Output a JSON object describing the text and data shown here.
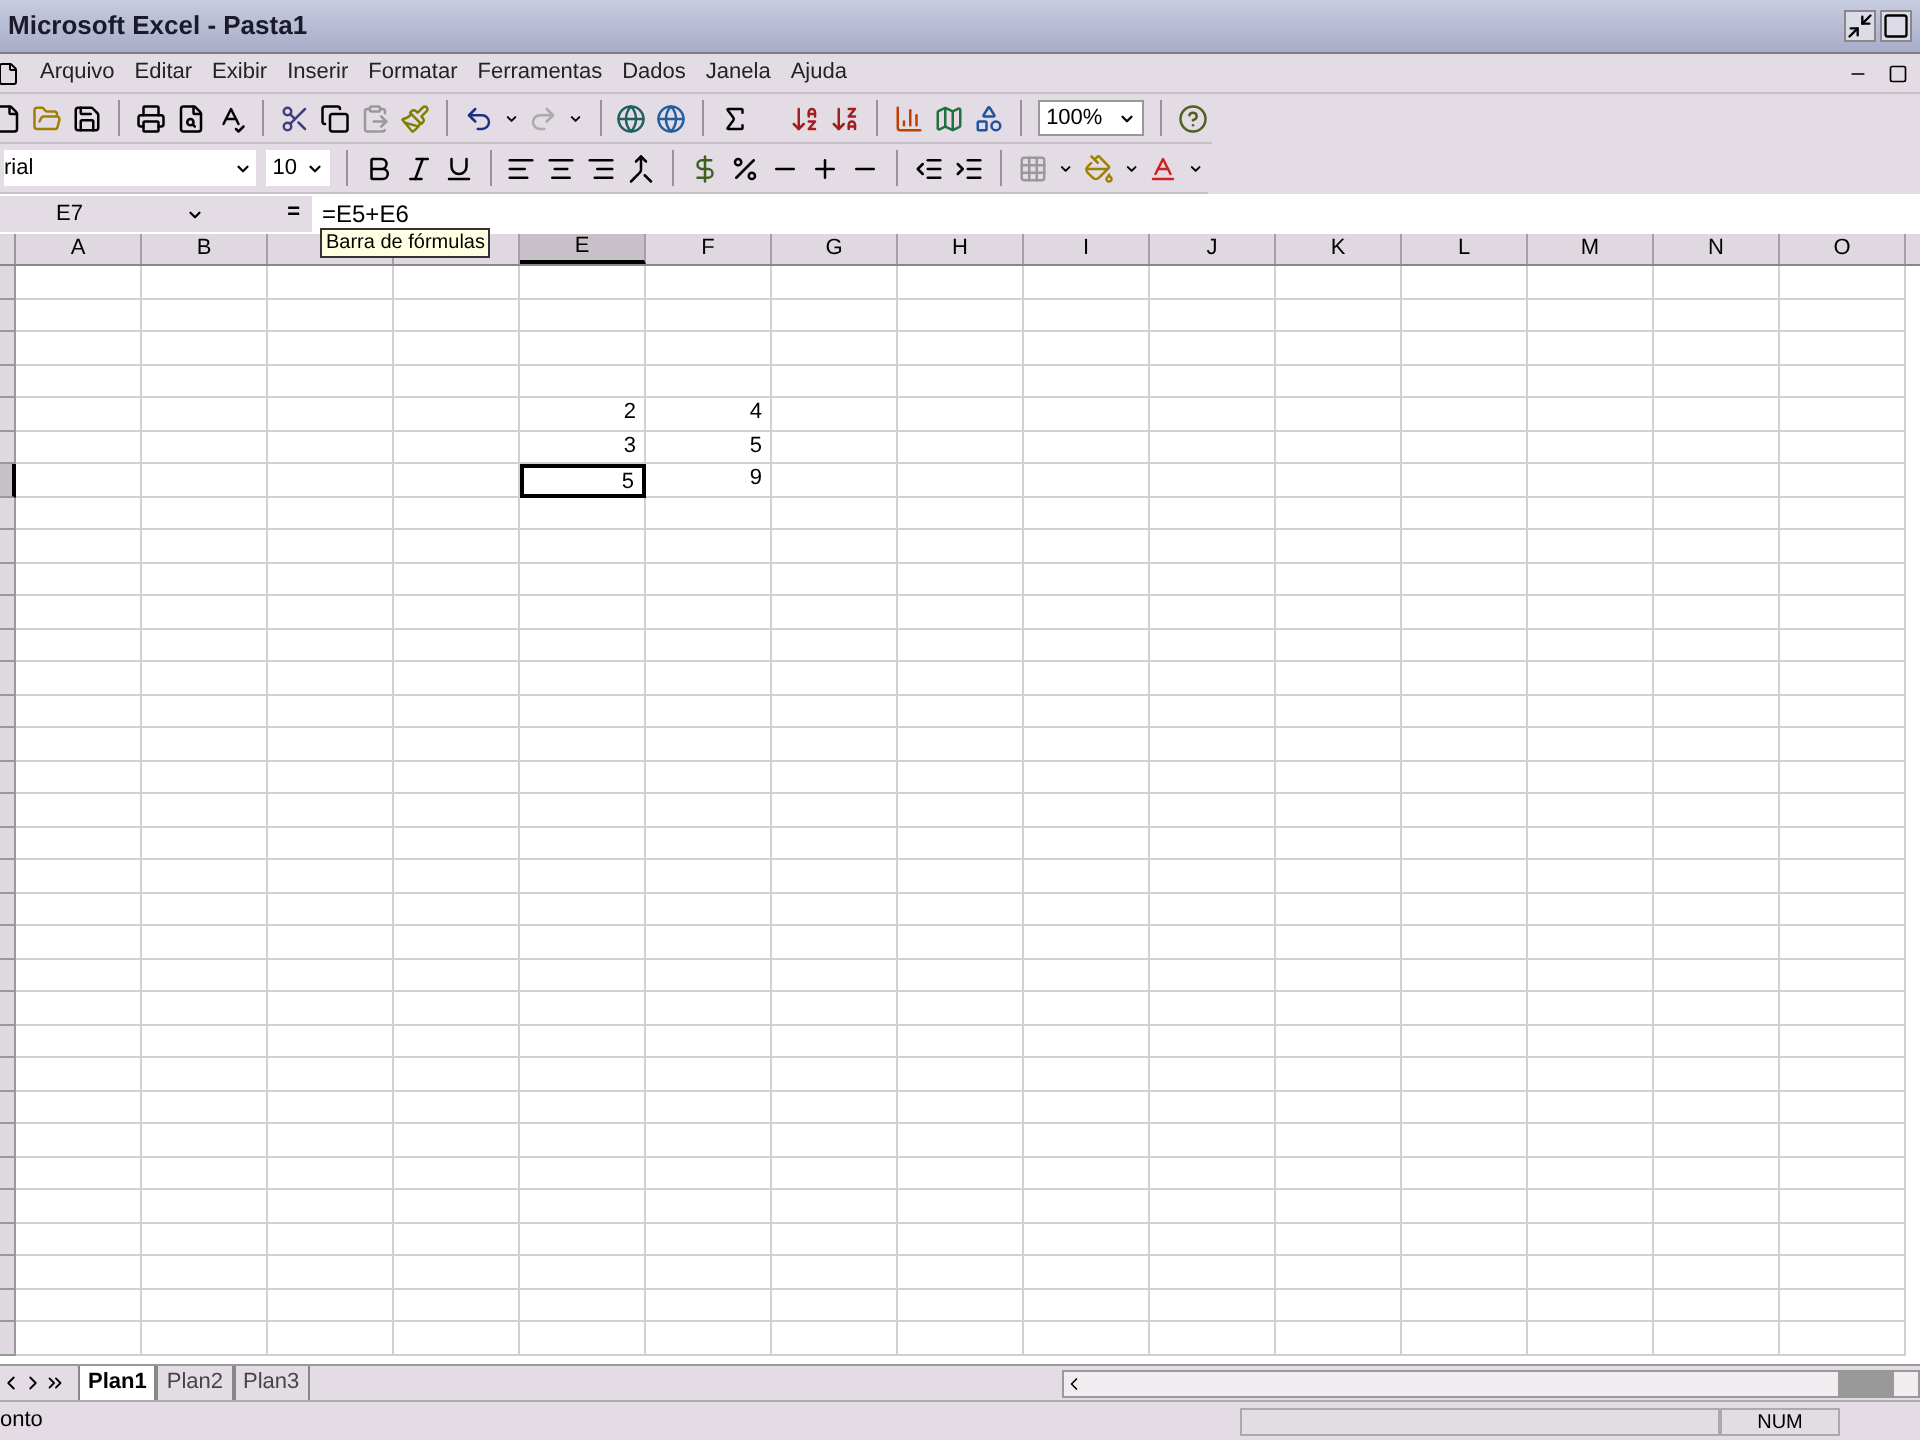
{
  "window": {
    "title": "Microsoft Excel - Pasta1"
  },
  "menu": [
    "Arquivo",
    "Editar",
    "Exibir",
    "Inserir",
    "Formatar",
    "Ferramentas",
    "Dados",
    "Janela",
    "Ajuda"
  ],
  "standard_toolbar": {
    "zoom": "100%"
  },
  "formatting_toolbar": {
    "font": "rial",
    "size": "10"
  },
  "formula_bar": {
    "name_box": "E7",
    "equals": "=",
    "formula": "=E5+E6",
    "tooltip": "Barra de fórmulas"
  },
  "columns": [
    {
      "label": "A",
      "selected": false
    },
    {
      "label": "B",
      "selected": false
    },
    {
      "selected": false
    },
    {
      "selected": false
    },
    {
      "label": "E",
      "selected": true
    },
    {
      "label": "F",
      "selected": false
    },
    {
      "label": "G",
      "selected": false
    },
    {
      "label": "H",
      "selected": false
    },
    {
      "label": "I",
      "selected": false
    },
    {
      "label": "J",
      "selected": false
    },
    {
      "label": "K",
      "selected": false
    },
    {
      "label": "L",
      "selected": false
    },
    {
      "label": "M",
      "selected": false
    },
    {
      "label": "N",
      "selected": false
    },
    {
      "label": "O",
      "selected": false
    }
  ],
  "rows": [
    {
      "selected": false
    },
    {
      "selected": false
    },
    {
      "selected": false
    },
    {
      "selected": false
    },
    {
      "selected": false,
      "cells": [
        {},
        {},
        {},
        {},
        {
          "value": "2",
          "selected": false
        },
        {
          "value": "4",
          "selected": false
        }
      ]
    },
    {
      "selected": false,
      "cells": [
        {},
        {},
        {},
        {},
        {
          "value": "3",
          "selected": false
        },
        {
          "value": "5",
          "selected": false
        }
      ]
    },
    {
      "selected": true,
      "cells": [
        {},
        {},
        {},
        {},
        {
          "value": "5",
          "selected": true
        },
        {
          "value": "9",
          "selected": false
        }
      ]
    },
    {
      "selected": false
    },
    {
      "selected": false
    },
    {
      "selected": false
    },
    {
      "selected": false
    },
    {
      "selected": false
    },
    {
      "selected": false
    },
    {
      "selected": false
    },
    {
      "selected": false
    },
    {
      "selected": false
    },
    {
      "selected": false
    },
    {
      "selected": false
    },
    {
      "selected": false
    },
    {
      "selected": false
    },
    {
      "selected": false
    },
    {
      "selected": false
    },
    {
      "selected": false
    },
    {
      "selected": false
    },
    {
      "selected": false
    },
    {
      "selected": false
    },
    {
      "selected": false
    },
    {
      "selected": false
    },
    {
      "selected": false
    },
    {
      "selected": false
    },
    {
      "selected": false
    },
    {
      "selected": false
    },
    {
      "selected": false
    }
  ],
  "sheet_tabs": [
    {
      "label": "Plan1",
      "selected": true
    },
    {
      "label": "Plan2",
      "selected": false
    },
    {
      "label": "Plan3",
      "selected": false
    }
  ],
  "status_bar": {
    "status": "onto",
    "num": "NUM"
  }
}
